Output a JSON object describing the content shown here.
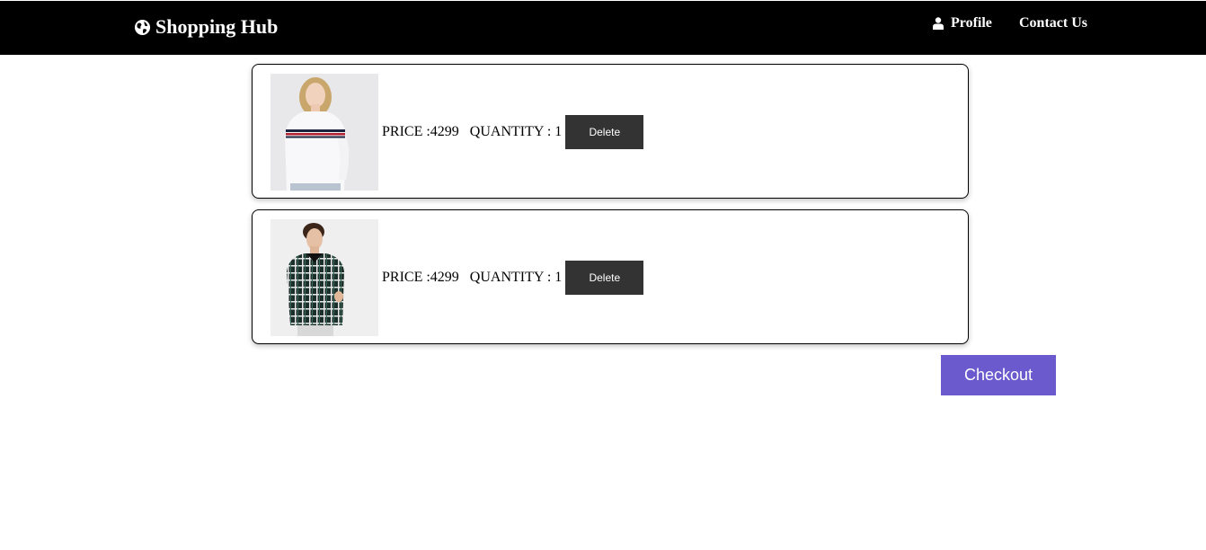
{
  "navbar": {
    "brand": "Shopping Hub",
    "brand_icon": "globe-icon",
    "links": [
      {
        "label": "Profile",
        "icon": "user-icon"
      },
      {
        "label": "Contact Us"
      }
    ]
  },
  "cart": {
    "items": [
      {
        "image": "product-photo-woman-white-sweater",
        "price_text": "PRICE :4299",
        "quantity_text": "QUANTITY : 1",
        "delete_label": "Delete"
      },
      {
        "image": "product-photo-man-plaid-shirt",
        "price_text": "PRICE :4299",
        "quantity_text": "QUANTITY : 1",
        "delete_label": "Delete"
      }
    ],
    "checkout_label": "Checkout"
  },
  "colors": {
    "navbar_bg": "#000000",
    "delete_button_bg": "#333333",
    "checkout_button_bg": "#6a5acd"
  }
}
